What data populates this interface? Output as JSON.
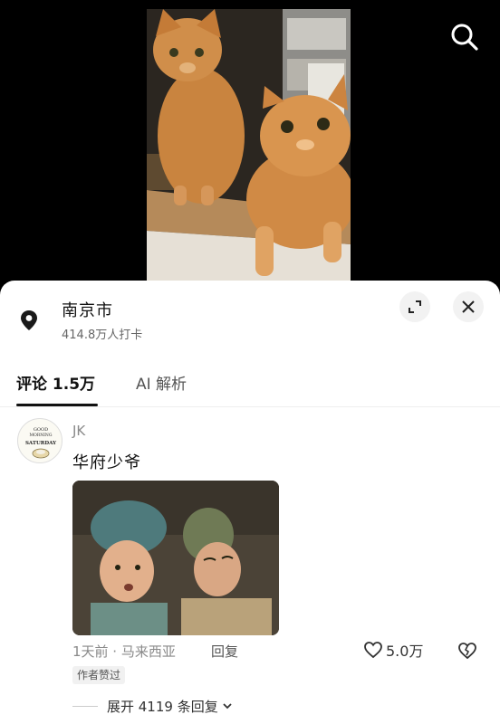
{
  "location": {
    "title": "南京市",
    "checkins": "414.8万人打卡"
  },
  "tabs": [
    {
      "label": "评论 1.5万",
      "active": true
    },
    {
      "label": "AI 解析",
      "active": false
    }
  ],
  "comment": {
    "author": "JK",
    "avatar_text": {
      "line1": "GOOD",
      "line2": "MORNING",
      "line3": "SATURDAY"
    },
    "text": "华府少爷",
    "time_location": "1天前 · 马来西亚",
    "reply_label": "回复",
    "likes": "5.0万",
    "author_badge": "作者赞过",
    "expand_label": "展开 4119 条回复"
  },
  "icons": {
    "search": "search-icon",
    "location": "location-pin-icon",
    "expand": "expand-icon",
    "close": "close-icon",
    "like": "heart-outline-icon",
    "dislike": "broken-heart-icon",
    "chevron": "chevron-down-icon"
  },
  "colors": {
    "background": "#000000",
    "sheet": "#ffffff",
    "muted_text": "#8a8a8a",
    "badge_bg": "#f1f1f1"
  }
}
